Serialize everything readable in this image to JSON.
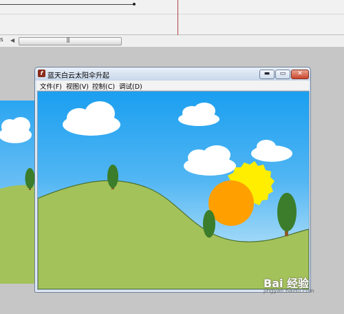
{
  "window": {
    "title": "蓝天白云太阳伞升起",
    "app_icon_glyph": "f",
    "buttons": {
      "minimize_glyph": "▬",
      "maximize_glyph": "▭",
      "close_glyph": "✕"
    }
  },
  "menu": {
    "items": [
      {
        "label": "文件(F)"
      },
      {
        "label": "视图(V)"
      },
      {
        "label": "控制(C)"
      },
      {
        "label": "调试(D)"
      }
    ]
  },
  "editor": {
    "scroll_label": "s",
    "scroll_left_glyph": "◀",
    "scroll_thumb_grip": "|||"
  },
  "scene": {
    "sky_color": "#1b9ff0",
    "hill_color": "#a4c25a",
    "sun_color": "#ff9f00",
    "sun_glow_color": "#ffee00",
    "tree_color": "#3b7d2a",
    "trunk_color": "#8b5a2b",
    "cloud_color": "#ffffff"
  },
  "watermark": {
    "text": "Bai 经验",
    "url": "jingyan.baidu.com"
  }
}
